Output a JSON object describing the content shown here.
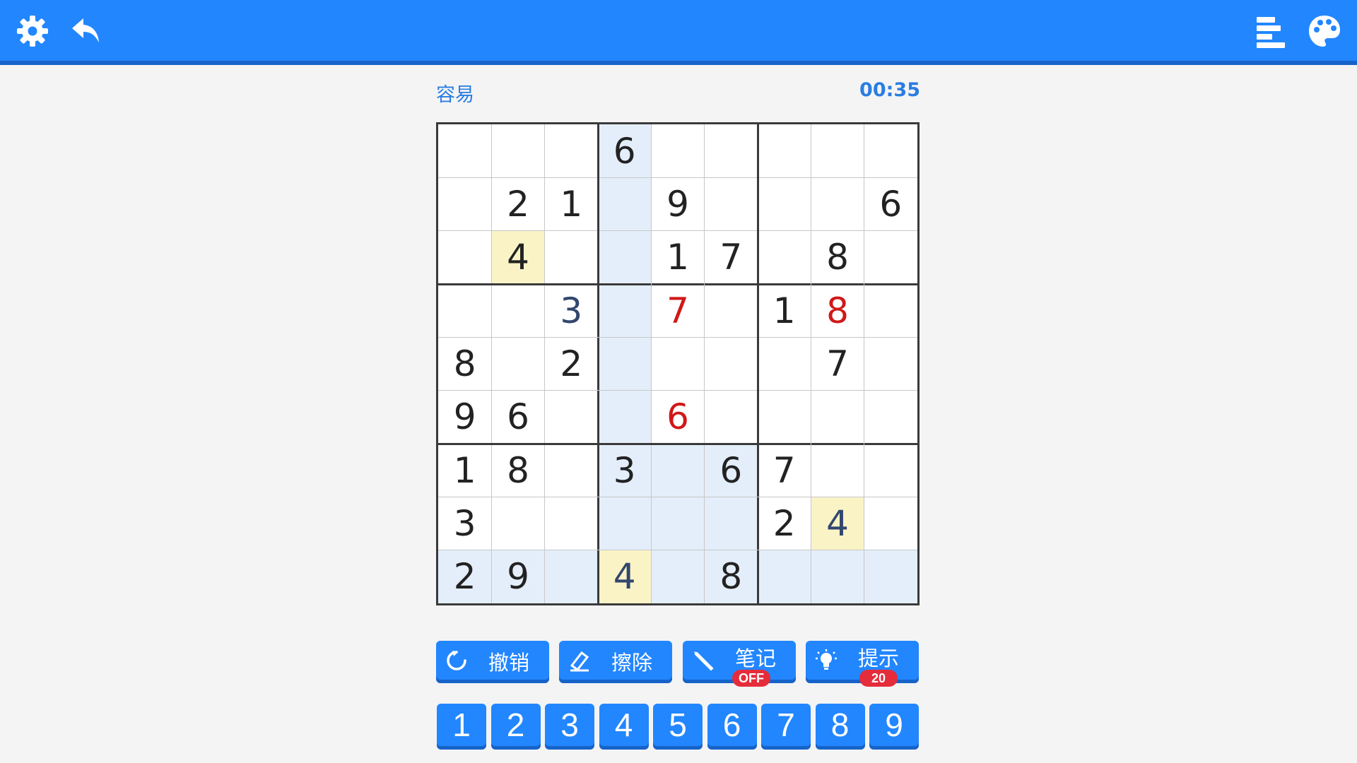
{
  "header": {
    "settings_icon": "gear-icon",
    "undo_icon": "back-arrow-icon",
    "stats_icon": "bars-icon",
    "theme_icon": "palette-icon"
  },
  "game": {
    "difficulty": "容易",
    "timer": "00:35"
  },
  "board": {
    "cells": [
      [
        "",
        "",
        "",
        "6",
        "",
        "",
        "",
        "",
        ""
      ],
      [
        "",
        "2",
        "1",
        "",
        "9",
        "",
        "",
        "",
        "6"
      ],
      [
        "",
        "4",
        "",
        "",
        "1",
        "7",
        "",
        "8",
        ""
      ],
      [
        "",
        "",
        "3",
        "",
        "7",
        "",
        "1",
        "8",
        ""
      ],
      [
        "8",
        "",
        "2",
        "",
        "",
        "",
        "",
        "7",
        ""
      ],
      [
        "9",
        "6",
        "",
        "",
        "6",
        "",
        "",
        "",
        ""
      ],
      [
        "1",
        "8",
        "",
        "3",
        "",
        "6",
        "7",
        "",
        ""
      ],
      [
        "3",
        "",
        "",
        "",
        "",
        "",
        "2",
        "4",
        ""
      ],
      [
        "2",
        "9",
        "",
        "4",
        "",
        "8",
        "",
        "",
        ""
      ]
    ],
    "user_entries": [
      [
        3,
        2
      ],
      [
        7,
        7
      ],
      [
        8,
        3
      ]
    ],
    "error_entries": [
      [
        3,
        4
      ],
      [
        3,
        7
      ],
      [
        5,
        4
      ]
    ],
    "highlighted_cells": [
      [
        0,
        3
      ],
      [
        1,
        3
      ],
      [
        2,
        3
      ],
      [
        3,
        3
      ],
      [
        4,
        3
      ],
      [
        5,
        3
      ],
      [
        6,
        3
      ],
      [
        7,
        3
      ],
      [
        8,
        3
      ],
      [
        6,
        4
      ],
      [
        6,
        5
      ],
      [
        7,
        4
      ],
      [
        7,
        5
      ],
      [
        8,
        0
      ],
      [
        8,
        1
      ],
      [
        8,
        2
      ],
      [
        8,
        4
      ],
      [
        8,
        5
      ],
      [
        8,
        6
      ],
      [
        8,
        7
      ],
      [
        8,
        8
      ]
    ],
    "same_number_cells": [
      [
        2,
        1
      ],
      [
        7,
        7
      ],
      [
        8,
        3
      ]
    ],
    "colors": {
      "highlight": "#e4eefb",
      "same_number": "#faf3c6",
      "user_digit": "#32476e",
      "error_digit": "#d01818",
      "given_digit": "#222222"
    }
  },
  "actions": {
    "undo": {
      "label": "撤销",
      "icon": "rotate-icon"
    },
    "erase": {
      "label": "擦除",
      "icon": "eraser-icon"
    },
    "notes": {
      "label": "笔记",
      "icon": "pencil-icon",
      "badge": "OFF"
    },
    "hint": {
      "label": "提示",
      "icon": "lightbulb-icon",
      "badge": "20"
    }
  },
  "numpad": [
    "1",
    "2",
    "3",
    "4",
    "5",
    "6",
    "7",
    "8",
    "9"
  ],
  "theme": {
    "primary": "#2286ff",
    "primary_dark": "#1663c9",
    "badge": "#e52c3a"
  }
}
